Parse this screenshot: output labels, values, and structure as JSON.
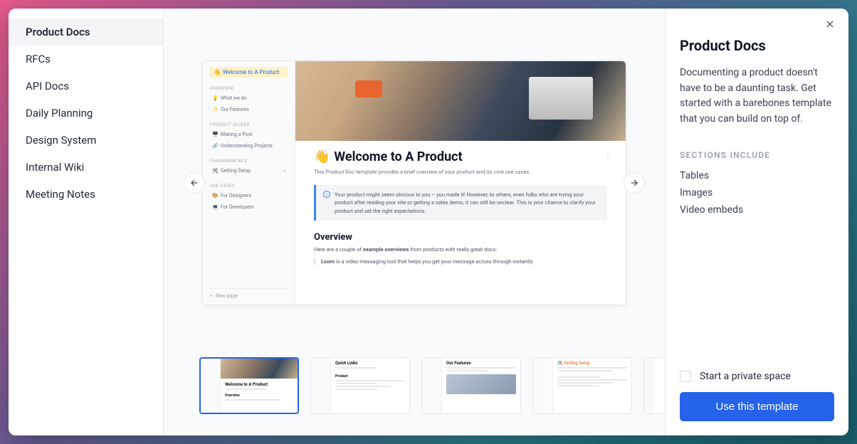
{
  "sidebar": {
    "items": [
      {
        "label": "Product Docs",
        "active": true
      },
      {
        "label": "RFCs"
      },
      {
        "label": "API Docs"
      },
      {
        "label": "Daily Planning"
      },
      {
        "label": "Design System"
      },
      {
        "label": "Internal Wiki"
      },
      {
        "label": "Meeting Notes"
      }
    ]
  },
  "preview": {
    "nav": {
      "current": "Welcome to A Product",
      "sections": {
        "overview": {
          "label": "OVERVIEW",
          "items": [
            "What we do",
            "Our Features"
          ]
        },
        "product_guides": {
          "label": "PRODUCT GUIDES",
          "items": [
            "Making a Post",
            "Understanding Projects"
          ]
        },
        "fundamentals": {
          "label": "FUNDAMENTALS",
          "items": [
            "Getting Setup"
          ]
        },
        "use_cases": {
          "label": "USE CASES",
          "items": [
            "For Designers",
            "For Developers"
          ]
        }
      },
      "new_page": "New page"
    },
    "content": {
      "title": "Welcome to A Product",
      "emoji": "👋",
      "subtitle": "This Product Doc template provides a brief overview of your product and its core use cases.",
      "callout": "Your product might seem obvious to you – you made it! However, to others, even folks who are trying your product after reading your site or getting a sales demo, it can still be unclear. This is your chance to clarify your product and set the right expectations.",
      "overview_heading": "Overview",
      "overview_text_prefix": "Here are a couple of ",
      "overview_text_bold": "example overviews",
      "overview_text_suffix": " from products with really great docs:",
      "loom_bold": "Loom",
      "loom_text": " is a video messaging tool that helps you get your message across through instantly"
    }
  },
  "thumbnails": [
    {
      "title": "Welcome to A Product",
      "active": true,
      "hero": true
    },
    {
      "title": "Quick Links",
      "sub": "Product"
    },
    {
      "title": "Our Features",
      "image": true
    },
    {
      "title": "Getting Setup"
    },
    {
      "title": ""
    }
  ],
  "panel": {
    "title": "Product Docs",
    "description": "Documenting a product doesn't have to be a daunting task. Get started with a barebones template that you can build on top of.",
    "sections_header": "SECTIONS INCLUDE",
    "sections": [
      "Tables",
      "Images",
      "Video embeds"
    ],
    "checkbox_label": "Start a private space",
    "button_label": "Use this template"
  }
}
